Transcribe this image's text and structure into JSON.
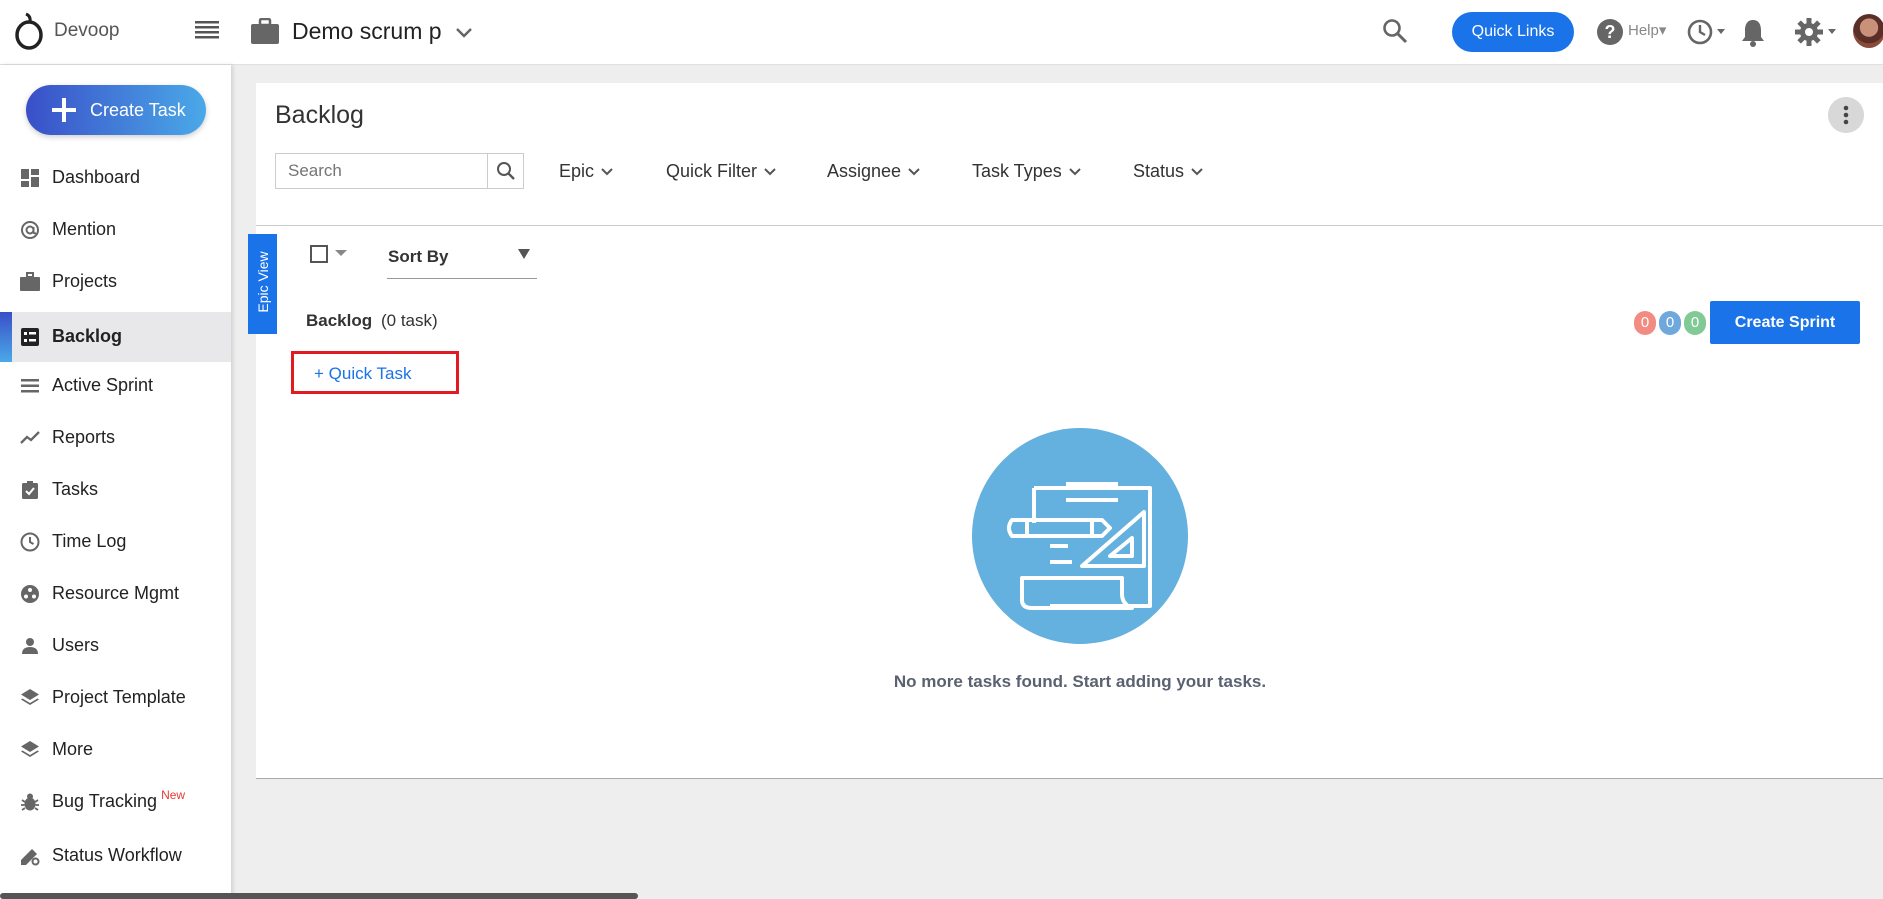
{
  "app": {
    "name": "Devoop"
  },
  "header": {
    "project_name": "Demo scrum p",
    "quick_links_label": "Quick Links",
    "help_label": "Help"
  },
  "sidebar": {
    "create_task_label": "Create Task",
    "items": [
      {
        "label": "Dashboard",
        "icon": "dashboard-icon"
      },
      {
        "label": "Mention",
        "icon": "at-icon"
      },
      {
        "label": "Projects",
        "icon": "briefcase-icon"
      },
      {
        "label": "Backlog",
        "icon": "backlog-icon",
        "active": true
      },
      {
        "label": "Active Sprint",
        "icon": "sprint-icon"
      },
      {
        "label": "Reports",
        "icon": "trend-icon"
      },
      {
        "label": "Tasks",
        "icon": "clipboard-check-icon"
      },
      {
        "label": "Time Log",
        "icon": "clock-icon"
      },
      {
        "label": "Resource Mgmt",
        "icon": "resource-icon"
      },
      {
        "label": "Users",
        "icon": "person-icon"
      },
      {
        "label": "Project Template",
        "icon": "layers-icon"
      },
      {
        "label": "More",
        "icon": "layers-icon"
      },
      {
        "label": "Bug Tracking",
        "icon": "bug-icon",
        "badge": "New"
      },
      {
        "label": "Status Workflow",
        "icon": "workflow-icon"
      }
    ]
  },
  "page": {
    "title": "Backlog",
    "search_placeholder": "Search",
    "filters": [
      "Epic",
      "Quick Filter",
      "Assignee",
      "Task Types",
      "Status"
    ],
    "epic_view_label": "Epic View",
    "sort_by_label": "Sort By",
    "backlog_label": "Backlog",
    "backlog_count": "(0 task)",
    "counters": [
      {
        "value": "0",
        "color": "#f28b82"
      },
      {
        "value": "0",
        "color": "#6fa8dc"
      },
      {
        "value": "0",
        "color": "#81c995"
      }
    ],
    "create_sprint_label": "Create Sprint",
    "quick_task_label": "+ Quick Task",
    "empty_message": "No more tasks found. Start adding your tasks."
  },
  "colors": {
    "accent": "#1a73e8",
    "highlight_border": "#e21b23",
    "illustration": "#64b0de"
  }
}
